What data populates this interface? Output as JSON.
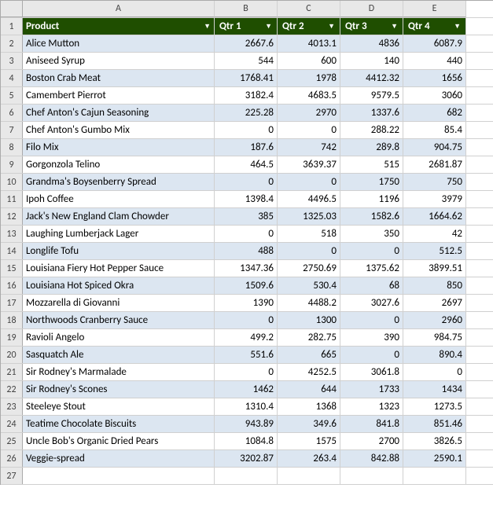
{
  "columns": {
    "rownum": "",
    "a_header": "A",
    "b_header": "B",
    "c_header": "C",
    "d_header": "D",
    "e_header": "E"
  },
  "header_row": {
    "rownum": "1",
    "product": "Product",
    "qtr1": "Qtr 1",
    "qtr2": "Qtr 2",
    "qtr3": "Qtr 3",
    "qtr4": "Qtr 4"
  },
  "rows": [
    {
      "num": "2",
      "product": "Alice Mutton",
      "q1": "2667.6",
      "q2": "4013.1",
      "q3": "4836",
      "q4": "6087.9"
    },
    {
      "num": "3",
      "product": "Aniseed Syrup",
      "q1": "544",
      "q2": "600",
      "q3": "140",
      "q4": "440"
    },
    {
      "num": "4",
      "product": "Boston Crab Meat",
      "q1": "1768.41",
      "q2": "1978",
      "q3": "4412.32",
      "q4": "1656"
    },
    {
      "num": "5",
      "product": "Camembert Pierrot",
      "q1": "3182.4",
      "q2": "4683.5",
      "q3": "9579.5",
      "q4": "3060"
    },
    {
      "num": "6",
      "product": "Chef Anton's Cajun Seasoning",
      "q1": "225.28",
      "q2": "2970",
      "q3": "1337.6",
      "q4": "682"
    },
    {
      "num": "7",
      "product": "Chef Anton's Gumbo Mix",
      "q1": "0",
      "q2": "0",
      "q3": "288.22",
      "q4": "85.4"
    },
    {
      "num": "8",
      "product": "Filo Mix",
      "q1": "187.6",
      "q2": "742",
      "q3": "289.8",
      "q4": "904.75"
    },
    {
      "num": "9",
      "product": "Gorgonzola Telino",
      "q1": "464.5",
      "q2": "3639.37",
      "q3": "515",
      "q4": "2681.87"
    },
    {
      "num": "10",
      "product": "Grandma's Boysenberry Spread",
      "q1": "0",
      "q2": "0",
      "q3": "1750",
      "q4": "750"
    },
    {
      "num": "11",
      "product": "Ipoh Coffee",
      "q1": "1398.4",
      "q2": "4496.5",
      "q3": "1196",
      "q4": "3979"
    },
    {
      "num": "12",
      "product": "Jack's New England Clam Chowder",
      "q1": "385",
      "q2": "1325.03",
      "q3": "1582.6",
      "q4": "1664.62"
    },
    {
      "num": "13",
      "product": "Laughing Lumberjack Lager",
      "q1": "0",
      "q2": "518",
      "q3": "350",
      "q4": "42"
    },
    {
      "num": "14",
      "product": "Longlife Tofu",
      "q1": "488",
      "q2": "0",
      "q3": "0",
      "q4": "512.5"
    },
    {
      "num": "15",
      "product": "Louisiana Fiery Hot Pepper Sauce",
      "q1": "1347.36",
      "q2": "2750.69",
      "q3": "1375.62",
      "q4": "3899.51"
    },
    {
      "num": "16",
      "product": "Louisiana Hot Spiced Okra",
      "q1": "1509.6",
      "q2": "530.4",
      "q3": "68",
      "q4": "850"
    },
    {
      "num": "17",
      "product": "Mozzarella di Giovanni",
      "q1": "1390",
      "q2": "4488.2",
      "q3": "3027.6",
      "q4": "2697"
    },
    {
      "num": "18",
      "product": "Northwoods Cranberry Sauce",
      "q1": "0",
      "q2": "1300",
      "q3": "0",
      "q4": "2960"
    },
    {
      "num": "19",
      "product": "Ravioli Angelo",
      "q1": "499.2",
      "q2": "282.75",
      "q3": "390",
      "q4": "984.75"
    },
    {
      "num": "20",
      "product": "Sasquatch Ale",
      "q1": "551.6",
      "q2": "665",
      "q3": "0",
      "q4": "890.4"
    },
    {
      "num": "21",
      "product": "Sir Rodney's Marmalade",
      "q1": "0",
      "q2": "4252.5",
      "q3": "3061.8",
      "q4": "0"
    },
    {
      "num": "22",
      "product": "Sir Rodney's Scones",
      "q1": "1462",
      "q2": "644",
      "q3": "1733",
      "q4": "1434"
    },
    {
      "num": "23",
      "product": "Steeleye Stout",
      "q1": "1310.4",
      "q2": "1368",
      "q3": "1323",
      "q4": "1273.5"
    },
    {
      "num": "24",
      "product": "Teatime Chocolate Biscuits",
      "q1": "943.89",
      "q2": "349.6",
      "q3": "841.8",
      "q4": "851.46"
    },
    {
      "num": "25",
      "product": "Uncle Bob's Organic Dried Pears",
      "q1": "1084.8",
      "q2": "1575",
      "q3": "2700",
      "q4": "3826.5"
    },
    {
      "num": "26",
      "product": "Veggie-spread",
      "q1": "3202.87",
      "q2": "263.4",
      "q3": "842.88",
      "q4": "2590.1"
    }
  ],
  "empty_row": {
    "num": "27"
  }
}
